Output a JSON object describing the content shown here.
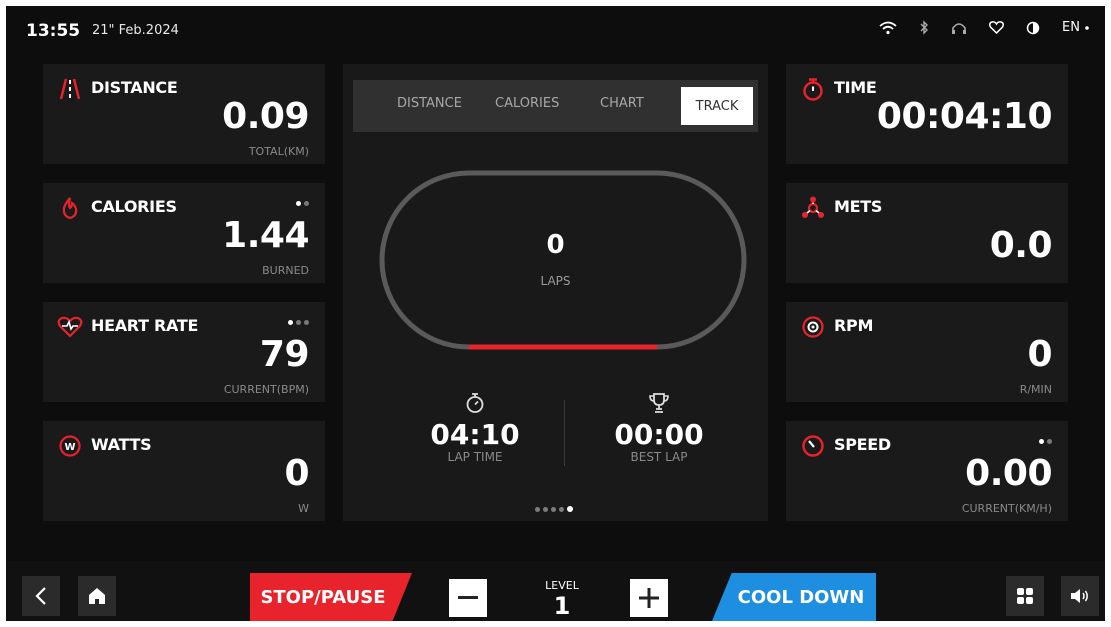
{
  "status": {
    "time": "13:55",
    "date": "21\" Feb.2024",
    "language": "EN"
  },
  "left_cards": [
    {
      "title": "DISTANCE",
      "value": "0.09",
      "unit": "TOTAL(KM)"
    },
    {
      "title": "CALORIES",
      "value": "1.44",
      "unit": "BURNED"
    },
    {
      "title": "HEART RATE",
      "value": "79",
      "unit": "CURRENT(BPM)"
    },
    {
      "title": "WATTS",
      "value": "0",
      "unit": "W"
    }
  ],
  "right_cards": [
    {
      "title": "TIME",
      "value": "00:04:10"
    },
    {
      "title": "METS",
      "value": "0.0"
    },
    {
      "title": "RPM",
      "value": "0",
      "unit": "R/MIN"
    },
    {
      "title": "SPEED",
      "value": "0.00",
      "unit": "CURRENT(KM/H)"
    }
  ],
  "tabs": [
    {
      "label": "DISTANCE"
    },
    {
      "label": "CALORIES"
    },
    {
      "label": "CHART"
    },
    {
      "label": "TRACK",
      "active": true
    }
  ],
  "track": {
    "laps_value": "0",
    "laps_label": "LAPS",
    "lap_time_value": "04:10",
    "lap_time_label": "LAP TIME",
    "best_lap_value": "00:00",
    "best_lap_label": "BEST LAP",
    "progress_color": "#e8232b"
  },
  "controls": {
    "stop_label": "STOP/PAUSE",
    "level_label": "LEVEL",
    "level_value": "1",
    "cooldown_label": "COOL DOWN"
  },
  "colors": {
    "accent_red": "#e8232b",
    "accent_blue": "#1e8fe0",
    "card_bg": "#1a1a1a",
    "screen_bg": "#0d0d0d"
  },
  "icons": [
    "wifi-icon",
    "bluetooth-icon",
    "headphones-icon",
    "heart-icon",
    "contrast-icon",
    "distance-icon",
    "flame-icon",
    "heart-rate-icon",
    "watts-icon",
    "stopwatch-icon",
    "mets-icon",
    "rpm-icon",
    "speed-icon",
    "trophy-icon",
    "back-icon",
    "home-icon",
    "minus-icon",
    "plus-icon",
    "grid-icon",
    "volume-icon"
  ]
}
